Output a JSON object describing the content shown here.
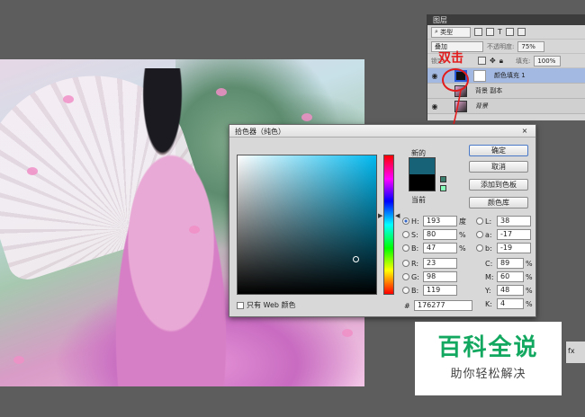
{
  "layers_panel": {
    "tab": "图层",
    "kind_label": "类型",
    "blend_mode": "叠加",
    "opacity_label": "不透明度:",
    "opacity_value": "75%",
    "lock_label": "锁定:",
    "fill_label": "填充:",
    "fill_value": "100%",
    "layers": [
      {
        "name": "颜色填充 1"
      },
      {
        "name": "背景 副本"
      },
      {
        "name": "背景"
      }
    ]
  },
  "annotation": {
    "text": "双击",
    "color": "#e21c1c"
  },
  "color_picker": {
    "title": "拾色器（纯色）",
    "close": "×",
    "new_label": "新的",
    "current_label": "当前",
    "new_color": "#176277",
    "current_color": "#000000",
    "buttons": {
      "ok": "确定",
      "cancel": "取消",
      "add_swatch": "添加到色板",
      "library": "颜色库"
    },
    "hsb": {
      "h_label": "H:",
      "h": "193",
      "h_unit": "度",
      "s_label": "S:",
      "s": "80",
      "s_unit": "%",
      "b_label": "B:",
      "b": "47",
      "b_unit": "%"
    },
    "rgb": {
      "r_label": "R:",
      "r": "23",
      "g_label": "G:",
      "g": "98",
      "b_label": "B:",
      "b": "119"
    },
    "lab": {
      "l_label": "L:",
      "l": "38",
      "a_label": "a:",
      "a": "-17",
      "b_label": "b:",
      "b": "-19"
    },
    "cmyk": {
      "c_label": "C:",
      "c": "89",
      "c_unit": "%",
      "m_label": "M:",
      "m": "60",
      "m_unit": "%",
      "y_label": "Y:",
      "y": "48",
      "y_unit": "%",
      "k_label": "K:",
      "k": "4",
      "k_unit": "%"
    },
    "hex_label": "#",
    "hex": "176277",
    "web_only": "只有 Web 颜色"
  },
  "watermark": {
    "title": "百科全说",
    "subtitle": "助你轻松解决",
    "title_color": "#13a85f"
  },
  "side_strip": {
    "label": "fx"
  }
}
